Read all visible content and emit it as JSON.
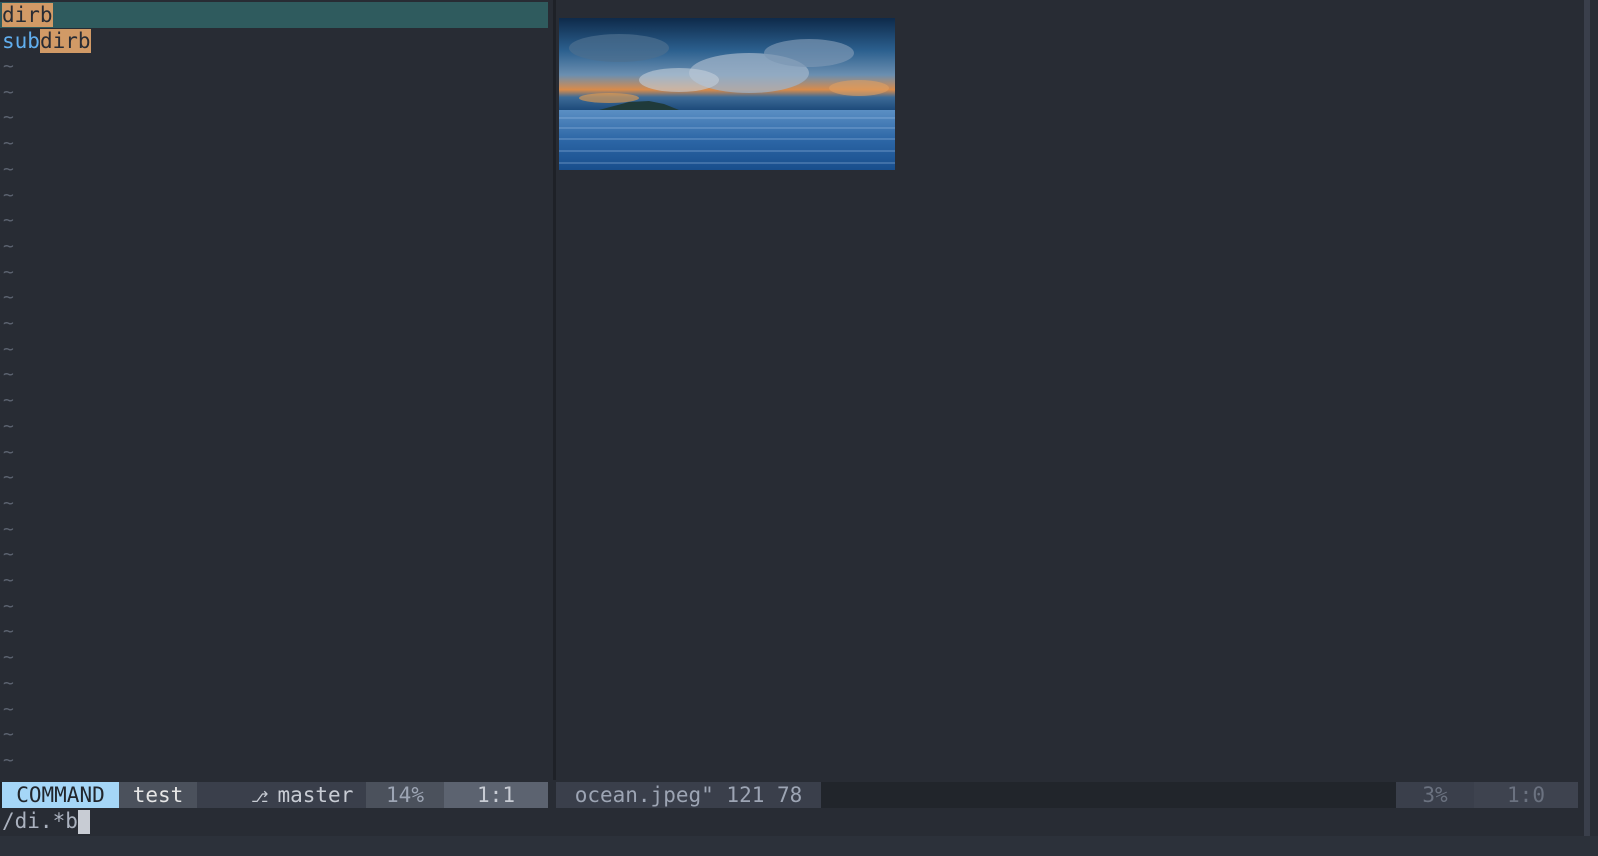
{
  "left_pane": {
    "lines": [
      {
        "prefix": "",
        "match": "dirb"
      },
      {
        "prefix": "sub",
        "match": "dirb"
      }
    ],
    "tilde": "~"
  },
  "right_pane": {
    "image_name": "ocean-image"
  },
  "left_status": {
    "mode": "COMMAND",
    "file": "test",
    "branch_icon": "git-branch-icon",
    "branch": "master",
    "percent": "14%",
    "position": "1:1"
  },
  "right_status": {
    "file": "ocean.jpeg\" 121 78",
    "percent": "3%",
    "position": "1:0"
  },
  "cmdline": {
    "text": "/di.*b"
  },
  "colors": {
    "background": "#282c34",
    "cursorline": "#2f5b5e",
    "match": "#d19a66",
    "directory": "#61afef",
    "mode": "#a5d6f7"
  }
}
